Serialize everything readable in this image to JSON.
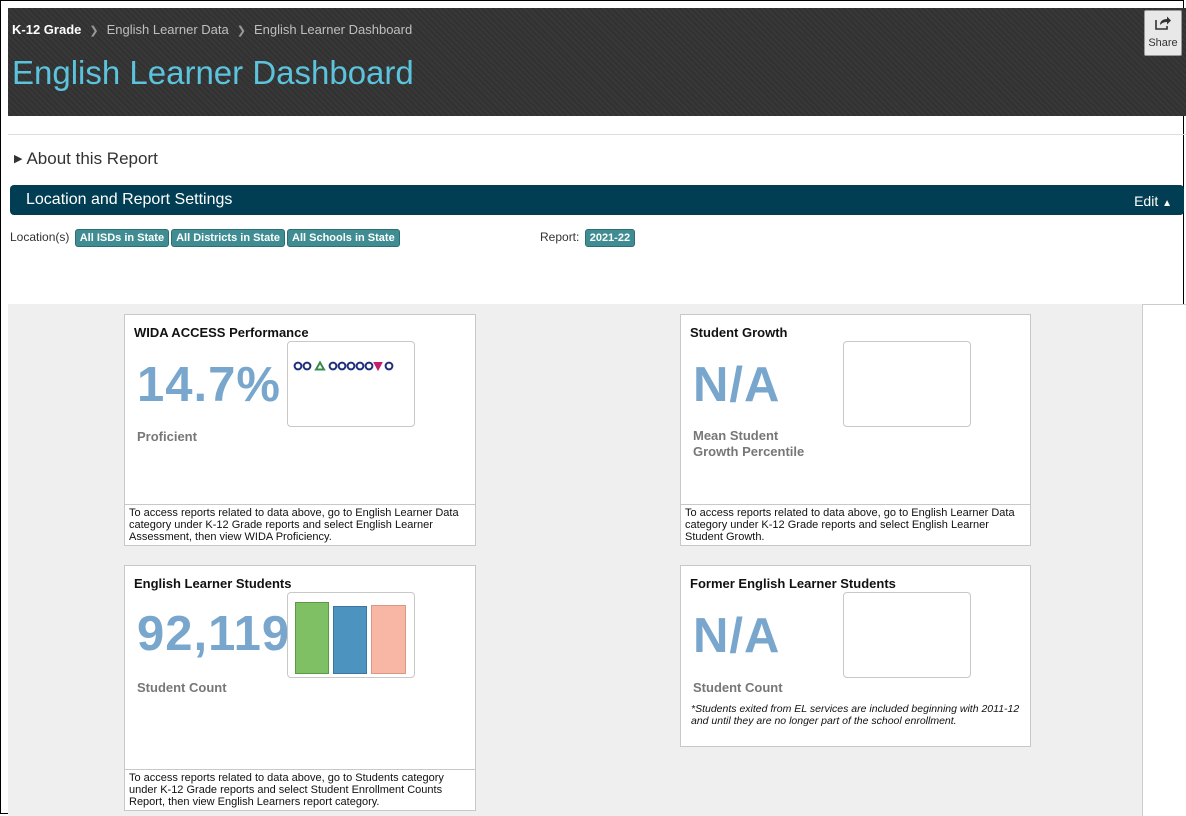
{
  "breadcrumb": {
    "items": [
      "K-12 Grade",
      "English Learner Data",
      "English Learner Dashboard"
    ]
  },
  "page_title": "English Learner Dashboard",
  "share_label": "Share",
  "about": {
    "label": "About this Report"
  },
  "settings": {
    "title": "Location and Report Settings",
    "edit_label": "Edit"
  },
  "location": {
    "label": "Location(s)",
    "pills": [
      "All ISDs in State",
      "All Districts in State",
      "All Schools in State"
    ]
  },
  "report": {
    "label": "Report:",
    "value": "2021-22"
  },
  "cards": {
    "wida": {
      "title": "WIDA ACCESS Performance",
      "value": "14.7%",
      "sub": "Proficient",
      "note": "To access reports related to data above, go to English Learner Data category under K-12 Grade reports and select English Learner Assessment, then view WIDA Proficiency."
    },
    "growth": {
      "title": "Student Growth",
      "value": "N/A",
      "sub_line1": "Mean Student",
      "sub_line2": "Growth Percentile",
      "note": "To access reports related to data above, go to English Learner Data category under K-12 Grade reports and select English Learner Student Growth."
    },
    "el_students": {
      "title": "English Learner Students",
      "value": "92,119",
      "sub": "Student Count",
      "note": "To access reports related to data above, go to Students category under K-12 Grade reports and select Student Enrollment Counts Report, then view English Learners report category.",
      "bar_colors": [
        "#80c065",
        "#4d93c0",
        "#f8b7a5"
      ]
    },
    "former_el": {
      "title": "Former English Learner Students",
      "value": "N/A",
      "sub": "Student Count",
      "footnote": "*Students exited from EL services are included beginning with 2011-12 and until they are no longer part of the school enrollment."
    }
  },
  "colors": {
    "header_bg": "#333333",
    "title": "#5bc3dc",
    "settings_bar": "#023e53",
    "pill": "#3f8d92",
    "big_value": "#78a6cc"
  }
}
